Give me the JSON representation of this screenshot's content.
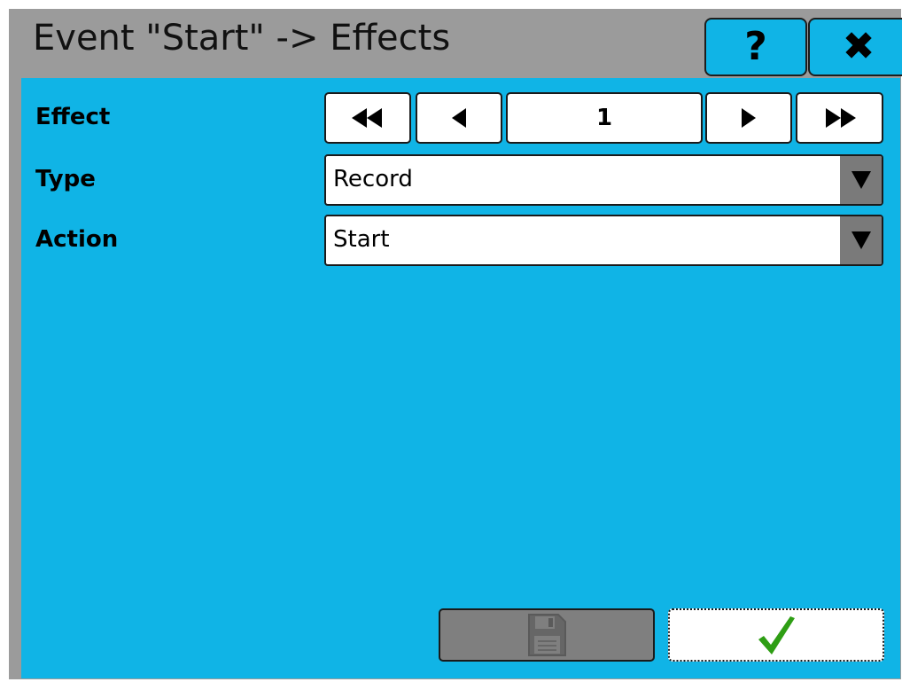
{
  "window": {
    "title": "Event \"Start\" -> Effects",
    "help_glyph": "?",
    "close_glyph": "✖"
  },
  "colors": {
    "accent": "#10b4e6",
    "frame": "#9b9b9b",
    "confirm_check": "#2e9e14",
    "disabled_button": "#7f7f7f"
  },
  "form": {
    "effect": {
      "label": "Effect",
      "index": "1",
      "nav_icons": [
        "first-icon",
        "previous-icon",
        "next-icon",
        "last-icon"
      ]
    },
    "type": {
      "label": "Type",
      "value": "Record"
    },
    "action": {
      "label": "Action",
      "value": "Start"
    }
  },
  "footer": {
    "save_icon": "save-icon",
    "save_enabled": false,
    "confirm_icon": "checkmark-icon"
  }
}
